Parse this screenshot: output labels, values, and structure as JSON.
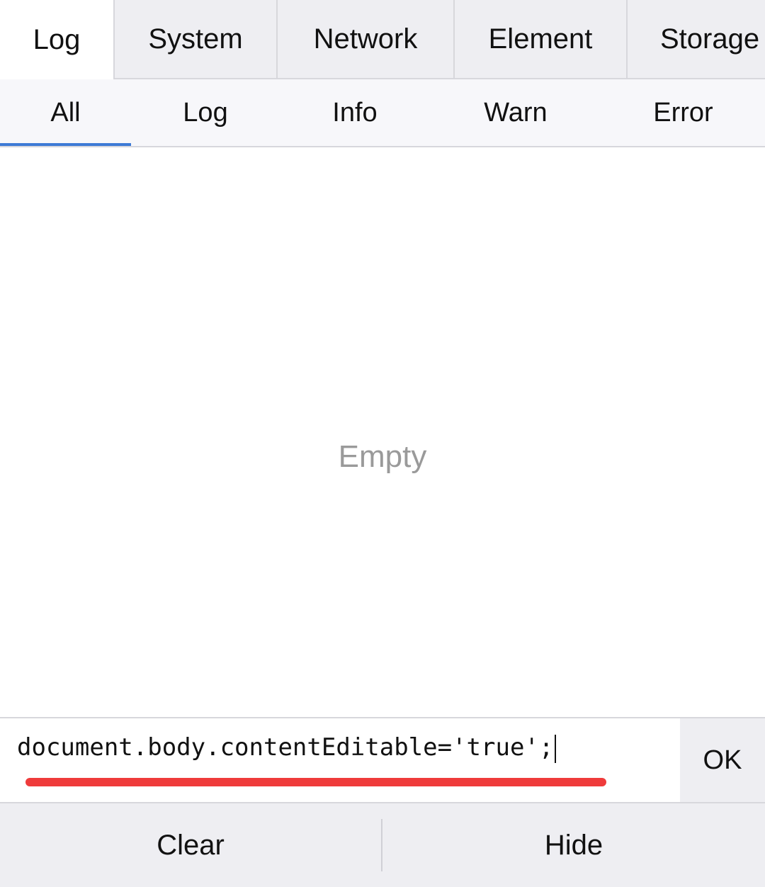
{
  "top_tabs": {
    "items": [
      {
        "label": "Log",
        "active": true
      },
      {
        "label": "System",
        "active": false
      },
      {
        "label": "Network",
        "active": false
      },
      {
        "label": "Element",
        "active": false
      },
      {
        "label": "Storage",
        "active": false
      }
    ]
  },
  "sub_tabs": {
    "items": [
      {
        "label": "All",
        "active": true
      },
      {
        "label": "Log",
        "active": false
      },
      {
        "label": "Info",
        "active": false
      },
      {
        "label": "Warn",
        "active": false
      },
      {
        "label": "Error",
        "active": false
      }
    ]
  },
  "log": {
    "empty_text": "Empty"
  },
  "command": {
    "value": "document.body.contentEditable='true';",
    "ok_label": "OK"
  },
  "toolbar": {
    "clear_label": "Clear",
    "hide_label": "Hide"
  },
  "colors": {
    "active_indicator": "#3d7ad6",
    "annotation_underline": "#ef3b3b",
    "bar_background": "#eeeef2",
    "empty_text": "#9a9a9a"
  }
}
